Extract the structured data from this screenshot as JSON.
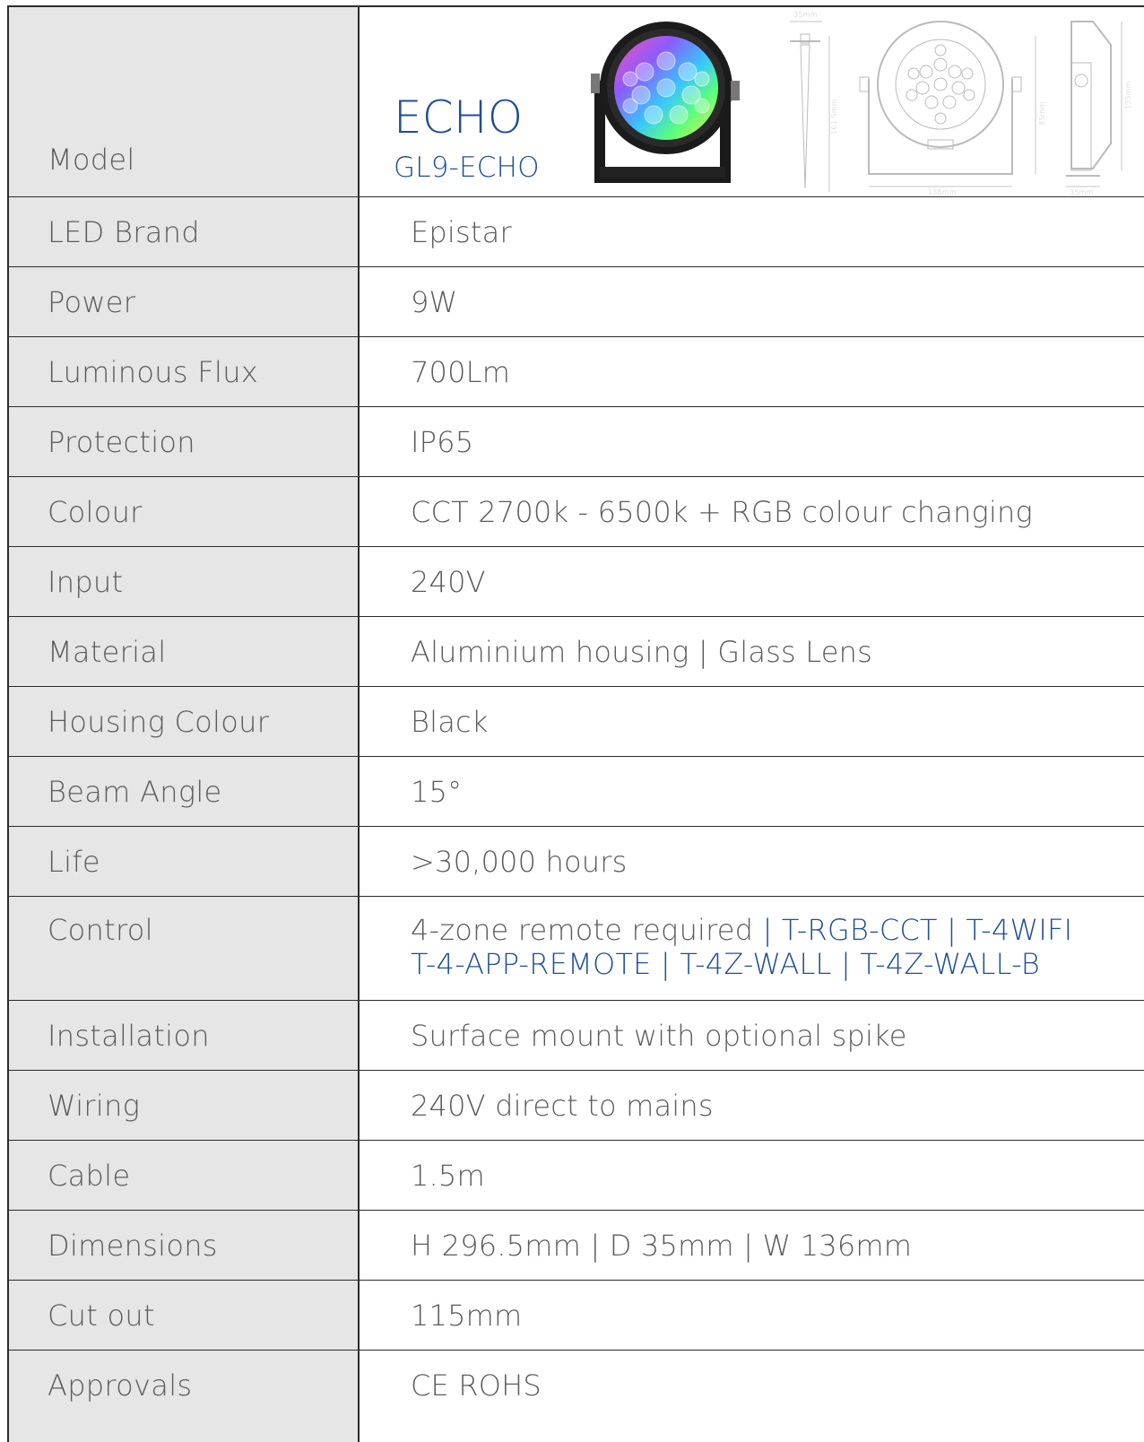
{
  "model": {
    "label": "Model",
    "name": "ECHO",
    "code": "GL9-ECHO",
    "drawing_dims": {
      "spike_width": "35mm",
      "spike_height": "161.5mm",
      "front_height": "85mm",
      "front_width": "136mm",
      "side_height": "135mm",
      "side_depth": "35mm"
    }
  },
  "rows": [
    {
      "label": "LED Brand",
      "value": "Epistar"
    },
    {
      "label": "Power",
      "value": "9W"
    },
    {
      "label": "Luminous Flux",
      "value": "700Lm"
    },
    {
      "label": "Protection",
      "value": "IP65"
    },
    {
      "label": "Colour",
      "value": "CCT  2700k - 6500k + RGB colour changing"
    },
    {
      "label": "Input",
      "value": "240V"
    },
    {
      "label": "Material",
      "value": "Aluminium housing | Glass Lens"
    },
    {
      "label": "Housing Colour",
      "value": "Black"
    },
    {
      "label": "Beam Angle",
      "value": "15°"
    },
    {
      "label": "Life",
      "value": ">30,000 hours"
    }
  ],
  "control": {
    "label": "Control",
    "line1_plain": "4-zone remote required ",
    "line1_links": "| T-RGB-CCT | T-4WIFI",
    "line2_links": "T-4-APP-REMOTE | T-4Z-WALL | T-4Z-WALL-B"
  },
  "rows_after": [
    {
      "label": "Installation",
      "value": "Surface mount with optional spike"
    },
    {
      "label": "Wiring",
      "value": "240V direct to mains"
    },
    {
      "label": "Cable",
      "value": "1.5m"
    },
    {
      "label": "Dimensions",
      "value": "H 296.5mm | D 35mm | W 136mm"
    },
    {
      "label": "Cut out",
      "value": "115mm"
    },
    {
      "label": "Approvals",
      "value": "CE  ROHS"
    }
  ],
  "colors": {
    "label_bg": "#e6e6e7",
    "accent_blue": "#1f4e96",
    "border": "#2b2b2b",
    "text": "#5c5c5c"
  }
}
